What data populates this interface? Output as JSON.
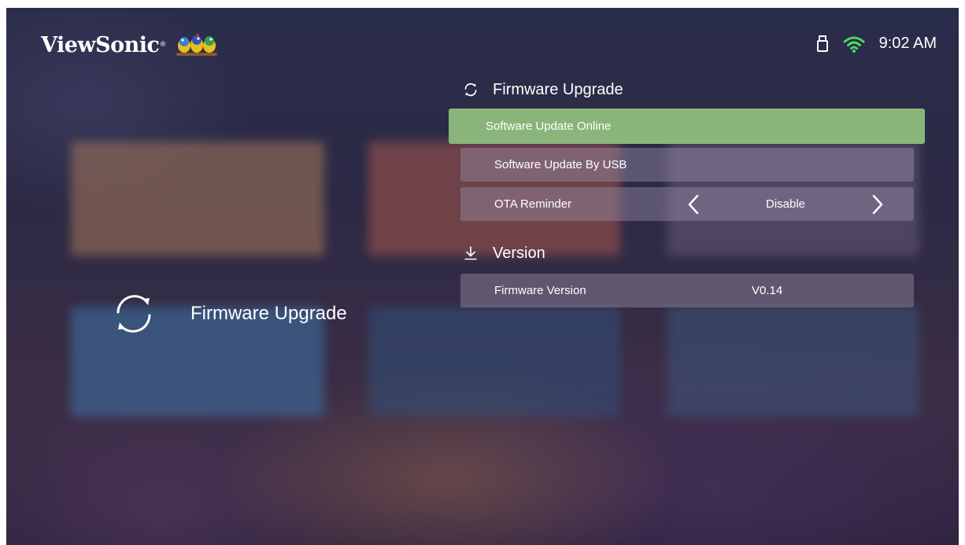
{
  "brand": {
    "name": "ViewSonic",
    "registered_mark": "®"
  },
  "status": {
    "usb_icon": "usb-icon",
    "wifi_icon": "wifi-icon",
    "wifi_color": "#4cd964",
    "time": "9:02 AM"
  },
  "category": {
    "icon": "refresh-icon",
    "label": "Firmware Upgrade"
  },
  "firmware_section": {
    "icon": "refresh-icon",
    "title": "Firmware Upgrade",
    "items": [
      {
        "label": "Software Update Online",
        "selected": true
      },
      {
        "label": "Software Update By USB",
        "selected": false
      },
      {
        "label": "OTA Reminder",
        "value": "Disable",
        "selected": false
      }
    ]
  },
  "version_section": {
    "icon": "download-icon",
    "title": "Version",
    "items": [
      {
        "label": "Firmware Version",
        "value": "V0.14"
      }
    ]
  },
  "colors": {
    "selected_row": "#89b57a",
    "row_background": "rgba(150,140,165,0.45)"
  }
}
